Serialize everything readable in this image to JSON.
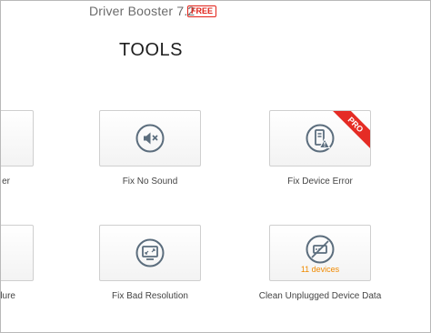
{
  "window": {
    "app_name": "Driver Booster 7.2",
    "badge": "FREE"
  },
  "page": {
    "title": "TOOLS"
  },
  "tools": {
    "row1": {
      "left_partial_label": "er",
      "fix_no_sound": "Fix No Sound",
      "fix_device_error": "Fix Device Error",
      "pro_badge": "PRO"
    },
    "row2": {
      "left_partial_label": "lure",
      "fix_bad_resolution": "Fix Bad Resolution",
      "clean_unplugged": "Clean Unplugged Device Data",
      "device_count": "11 devices"
    }
  },
  "icons": {
    "sound": "speaker-mute-icon",
    "device_error": "device-error-icon",
    "resolution": "monitor-resolution-icon",
    "unplugged": "unplugged-device-icon"
  },
  "colors": {
    "icon": "#5b6d7d",
    "pro_ribbon": "#e52c25",
    "device_count": "#f08a00",
    "free_badge": "#e2231a"
  }
}
